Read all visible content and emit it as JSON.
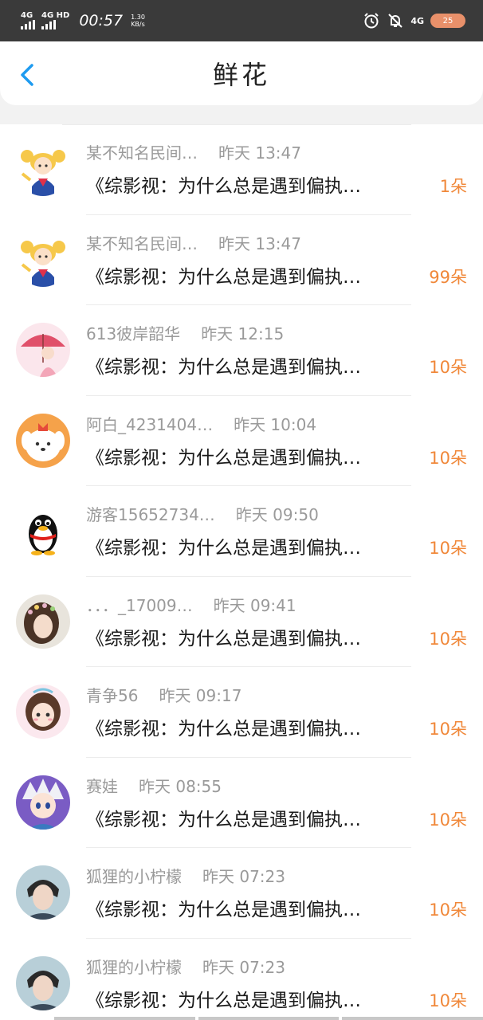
{
  "status_bar": {
    "signal1": "4G",
    "signal2": "4G HD",
    "time": "00:57",
    "speed_value": "1.30",
    "speed_unit": "KB/s",
    "network": "4G",
    "battery": "25"
  },
  "header": {
    "title": "鲜花"
  },
  "list": [
    {
      "name": "某不知名民间…",
      "time": "昨天 13:47",
      "message": "《综影视：为什么总是遇到偏执…",
      "count": "1朵",
      "avatar": "sailor-moon-cartoon"
    },
    {
      "name": "某不知名民间…",
      "time": "昨天 13:47",
      "message": "《综影视：为什么总是遇到偏执…",
      "count": "99朵",
      "avatar": "sailor-moon-cartoon"
    },
    {
      "name": "613彼岸韶华",
      "time": "昨天 12:15",
      "message": "《综影视：为什么总是遇到偏执…",
      "count": "10朵",
      "avatar": "girl-red-umbrella"
    },
    {
      "name": "阿白_4231404…",
      "time": "昨天 10:04",
      "message": "《综影视：为什么总是遇到偏执…",
      "count": "10朵",
      "avatar": "cartoon-puppy"
    },
    {
      "name": "游客15652734…",
      "time": "昨天 09:50",
      "message": "《综影视：为什么总是遇到偏执…",
      "count": "10朵",
      "avatar": "qq-penguin"
    },
    {
      "name": "．．．_17009…",
      "time": "昨天 09:41",
      "message": "《综影视：为什么总是遇到偏执…",
      "count": "10朵",
      "avatar": "girl-flower-crown"
    },
    {
      "name": "青争56",
      "time": "昨天 09:17",
      "message": "《综影视：为什么总是遇到偏执…",
      "count": "10朵",
      "avatar": "anime-girl"
    },
    {
      "name": "赛娃",
      "time": "昨天 08:55",
      "message": "《综影视：为什么总是遇到偏执…",
      "count": "10朵",
      "avatar": "anime-boy-white-hair"
    },
    {
      "name": "狐狸的小柠檬",
      "time": "昨天 07:23",
      "message": "《综影视：为什么总是遇到偏执…",
      "count": "10朵",
      "avatar": "man-portrait"
    },
    {
      "name": "狐狸的小柠檬",
      "time": "昨天 07:23",
      "message": "《综影视：为什么总是遇到偏执…",
      "count": "10朵",
      "avatar": "man-portrait"
    }
  ],
  "colors": {
    "accent": "#1e9bf0",
    "count": "#f0883a",
    "status_bar": "#3a3a3a"
  }
}
